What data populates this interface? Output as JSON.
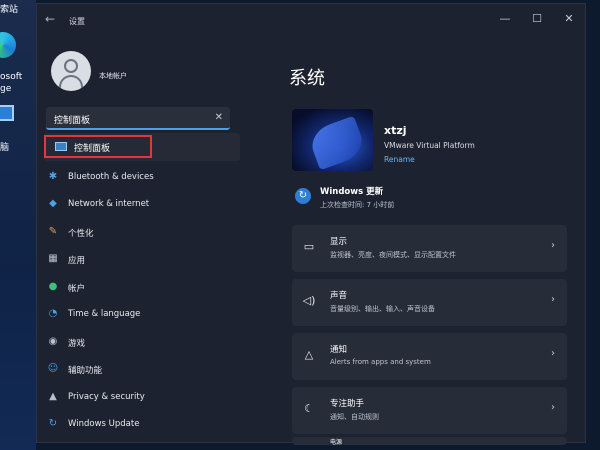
{
  "desktop": {
    "labels": [
      "索站",
      "osoft",
      "ge",
      "脑"
    ]
  },
  "window": {
    "title": "设置",
    "back_icon": "back-arrow-icon",
    "controls": [
      "—",
      "☐",
      "✕"
    ]
  },
  "account": {
    "name": "本地帐户"
  },
  "search": {
    "value": "控制面板",
    "clear": "✕"
  },
  "suggestion": {
    "label": "控制面板"
  },
  "nav": [
    {
      "label": "Bluetooth & devices",
      "icon": "✱",
      "color": "#4aa3e8"
    },
    {
      "label": "Network & internet",
      "icon": "◆",
      "color": "#4aa3e8"
    },
    {
      "label": "个性化",
      "icon": "✎",
      "color": "#e0a15a"
    },
    {
      "label": "应用",
      "icon": "▦",
      "color": "#b9c0cc"
    },
    {
      "label": "帐户",
      "icon": "●",
      "color": "#3bbf7a"
    },
    {
      "label": "Time & language",
      "icon": "◔",
      "color": "#4aa3e8"
    },
    {
      "label": "游戏",
      "icon": "◉",
      "color": "#b9c0cc"
    },
    {
      "label": "辅助功能",
      "icon": "☺",
      "color": "#4aa3e8"
    },
    {
      "label": "Privacy & security",
      "icon": "▲",
      "color": "#b9c0cc"
    },
    {
      "label": "Windows Update",
      "icon": "↻",
      "color": "#4aa3e8"
    }
  ],
  "main": {
    "title": "系统",
    "device": {
      "name": "xtzj",
      "platform": "VMware Virtual Platform",
      "rename": "Rename"
    },
    "update": {
      "title": "Windows 更新",
      "subtitle": "上次检查时间: 7 小时前"
    },
    "cards": [
      {
        "title": "显示",
        "sub": "监视器、亮度、夜间模式、显示配置文件",
        "icon": "▭"
      },
      {
        "title": "声音",
        "sub": "音量级别、输出、输入、声音设备",
        "icon": "◁)"
      },
      {
        "title": "通知",
        "sub": "Alerts from apps and system",
        "icon": "△"
      },
      {
        "title": "专注助手",
        "sub": "通知、自动规则",
        "icon": "☾"
      },
      {
        "title": "电源",
        "sub": "",
        "icon": ""
      }
    ],
    "chevron": "›"
  },
  "colors": {
    "accent": "#4aa3e8",
    "highlight_border": "#e0393a",
    "window_bg": "#1d2230",
    "card_bg": "#272c39"
  }
}
